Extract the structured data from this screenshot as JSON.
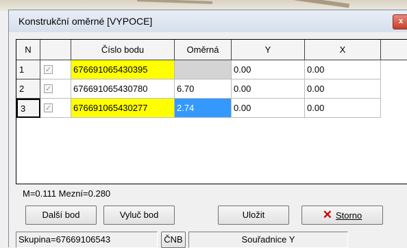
{
  "window": {
    "title": "Konstrukční oměrné [VYPOCE]",
    "close_glyph": "x"
  },
  "grid": {
    "columns": [
      "N",
      "",
      "Číslo bodu",
      "Oměrná",
      "Y",
      "X"
    ],
    "rows": [
      {
        "n": "1",
        "checked": true,
        "cislo": "676691065430395",
        "omerna": "",
        "y": "0.00",
        "x": "0.00"
      },
      {
        "n": "2",
        "checked": true,
        "cislo": "676691065430780",
        "omerna": "6.70",
        "y": "0.00",
        "x": "0.00"
      },
      {
        "n": "3",
        "checked": true,
        "cislo": "676691065430277",
        "omerna": "2.74",
        "y": "0.00",
        "x": "0.00"
      }
    ]
  },
  "status": "M=0.111 Mezní=0.280",
  "buttons": {
    "dalsi": "Další bod",
    "vyluc": "Vyluč bod",
    "ulozit": "Uložit",
    "storno": "Storno"
  },
  "footer": {
    "skupina": "Skupina=67669106543",
    "cnb": "ČNB",
    "souradnice": "Souřadnice Y"
  },
  "colors": {
    "highlight": "#ffff00",
    "selection": "#3399ff",
    "close": "#c4402a"
  }
}
